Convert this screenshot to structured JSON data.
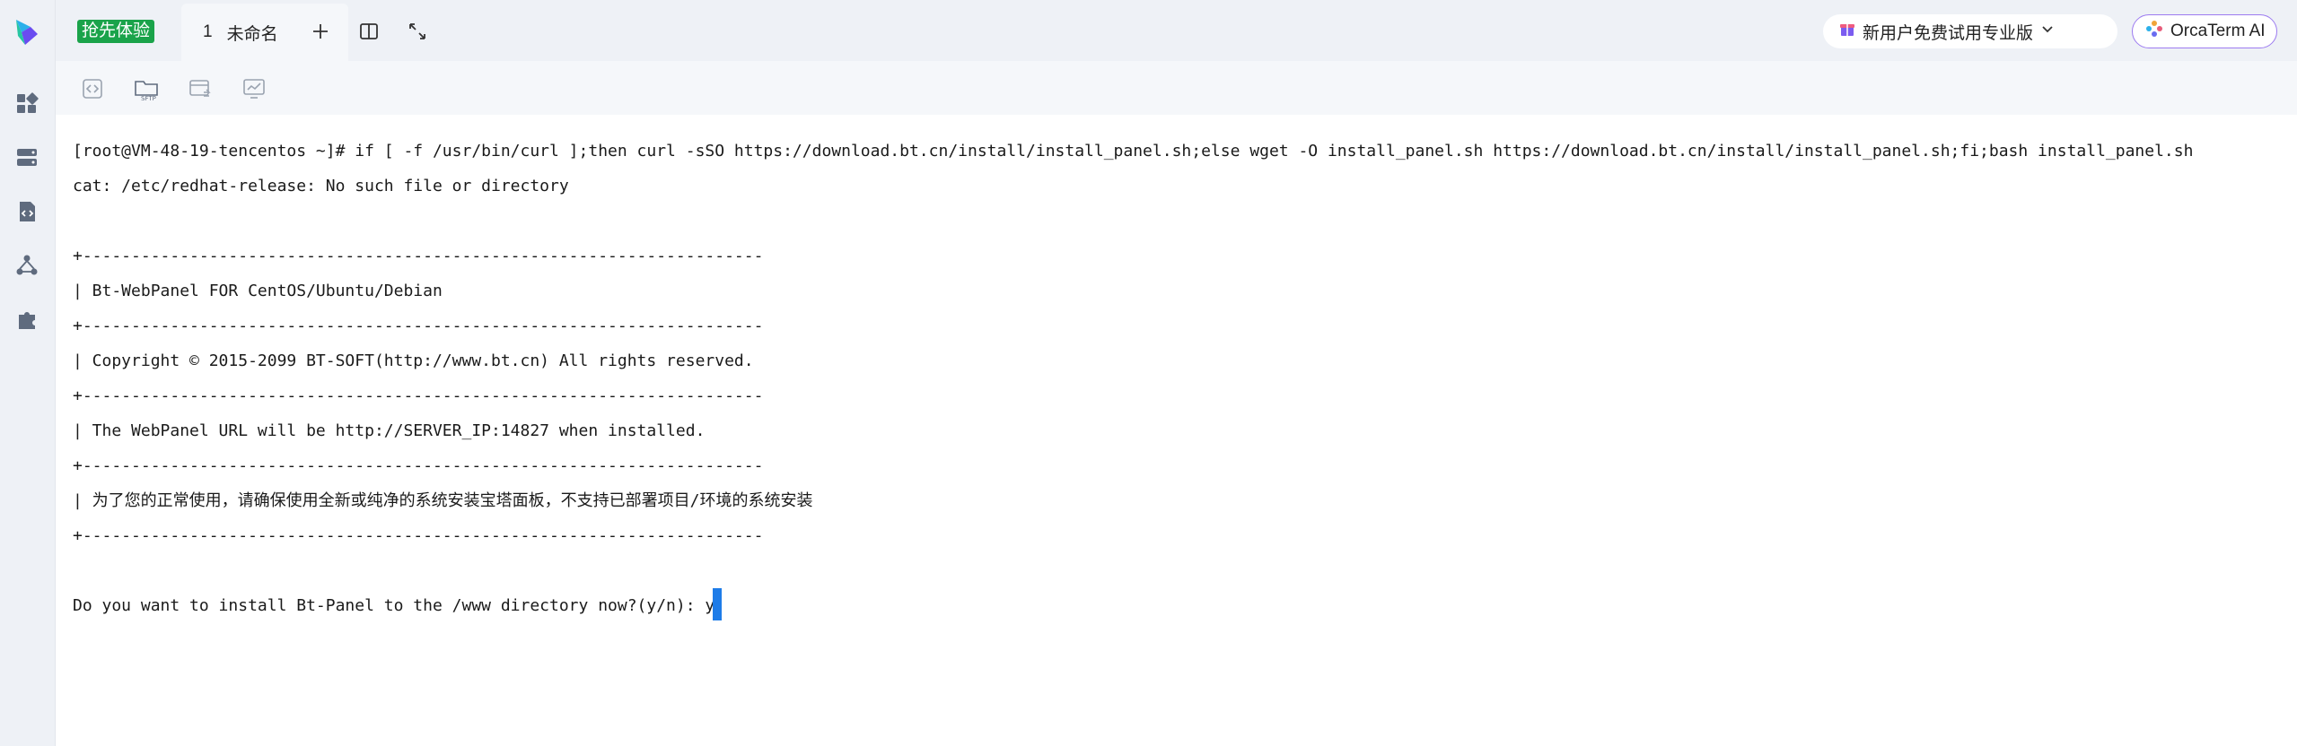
{
  "colors": {
    "rail_bg": "#eef1f6",
    "trial_badge_bg": "#1aa34a",
    "cursor": "#1e7ce8",
    "ai_border": "#9c7bf0"
  },
  "topbar": {
    "trial_badge": "抢先体验",
    "tab": {
      "index": "1",
      "title": "未命名"
    },
    "promo_label": "新用户免费试用专业版",
    "ai_label": "OrcaTerm AI"
  },
  "rail_icons": [
    "dashboard-icon",
    "server-icon",
    "code-file-icon",
    "network-icon",
    "plugin-icon"
  ],
  "toolbar_icons": [
    "code-icon",
    "sftp-folder-icon",
    "file-transfer-icon",
    "monitor-icon"
  ],
  "toolbar": {
    "sftp_caption": "SFTP"
  },
  "terminal": {
    "lines": [
      "[root@VM-48-19-tencentos ~]# if [ -f /usr/bin/curl ];then curl -sSO https://download.bt.cn/install/install_panel.sh;else wget -O install_panel.sh https://download.bt.cn/install/install_panel.sh;fi;bash install_panel.sh",
      "cat: /etc/redhat-release: No such file or directory",
      "",
      "+----------------------------------------------------------------------",
      "| Bt-WebPanel FOR CentOS/Ubuntu/Debian",
      "+----------------------------------------------------------------------",
      "| Copyright © 2015-2099 BT-SOFT(http://www.bt.cn) All rights reserved.",
      "+----------------------------------------------------------------------",
      "| The WebPanel URL will be http://SERVER_IP:14827 when installed.",
      "+----------------------------------------------------------------------",
      "| 为了您的正常使用，请确保使用全新或纯净的系统安装宝塔面板，不支持已部署项目/环境的系统安装",
      "+----------------------------------------------------------------------",
      "",
      "Do you want to install Bt-Panel to the /www directory now?(y/n): y"
    ]
  }
}
